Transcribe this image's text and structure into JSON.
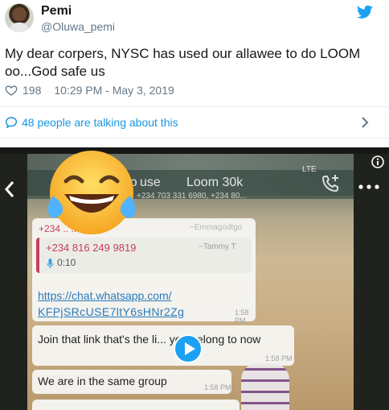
{
  "tweet": {
    "author_name": "Pemi",
    "author_handle": "@Oluwa_pemi",
    "text": "My dear corpers, NYSC has used our allawee to do LOOM oo...God safe us",
    "likes": "198",
    "timestamp": "10:29 PM - May 3, 2019",
    "talking": "48 people are talking about this"
  },
  "icons": {
    "brand": "twitter-bird-icon",
    "like": "heart-outline-icon",
    "reply": "speech-bubble-icon",
    "more": "chevron-right-icon",
    "play": "play-icon",
    "info": "info-icon",
    "emoji": "face-with-tears-of-joy-emoji"
  },
  "video": {
    "group_name_a": "Ho",
    "group_name_b": "use",
    "group_title_c": "Loom 30k",
    "members": "+234 703 331 6980, +234 80...",
    "status": "LTE",
    "message1": {
      "sender": "+234 .. .. 7068",
      "sender_name": "~Emmagodtgo",
      "quoted_number": "+234 816 249 9819",
      "quoted_name": "~Tammy T",
      "audio_duration": "0:10",
      "link_line1": "https://chat.whatsapp.com/",
      "link_line2": "KFPjSRcUSE7ltY6sHNr2Zg",
      "time": "1:58 PM"
    },
    "message2": {
      "text": "Join that link that's the li... you belong to now",
      "time": "1:58 PM"
    },
    "message3": {
      "text": "We are in the same group",
      "time": "1:58 PM"
    }
  },
  "colors": {
    "brand_blue": "#1da1f2",
    "link_blue": "#1b95e0",
    "secondary_text": "#657786"
  }
}
